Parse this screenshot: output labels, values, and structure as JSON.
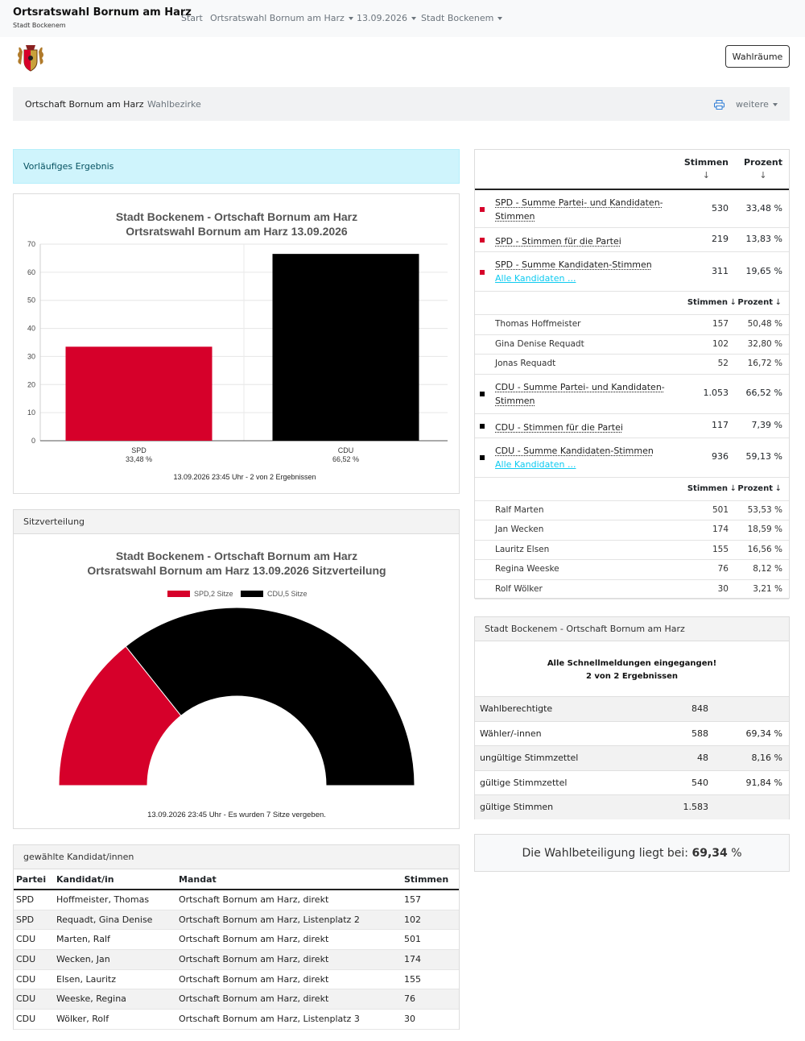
{
  "navbar": {
    "brand_title": "Ortsratswahl Bornum am Harz",
    "brand_sub": "Stadt Bockenem",
    "links": [
      "Start",
      "Ortsratswahl Bornum am Harz",
      "13.09.2026",
      "Stadt Bockenem"
    ]
  },
  "wahlraeume_label": "Wahlräume",
  "breadcrumb": {
    "item1": "Ortschaft Bornum am Harz",
    "item2": "Wahlbezirke",
    "more": "weitere"
  },
  "alert_text": "Vorläufiges Ergebnis",
  "colors": {
    "spd": "#d6002a",
    "cdu": "#000000",
    "info_bg": "#cff4fc"
  },
  "chart_data": [
    {
      "type": "bar",
      "title": "Stadt Bockenem - Ortschaft Bornum am Harz",
      "subtitle": "Ortsratswahl Bornum am Harz 13.09.2026",
      "categories": [
        "SPD",
        "CDU"
      ],
      "category_labels": [
        "33,48 %",
        "66,52 %"
      ],
      "values": [
        33.48,
        66.52
      ],
      "colors": [
        "#d6002a",
        "#000000"
      ],
      "ylim": [
        0,
        70
      ],
      "yticks": [
        "0",
        "10",
        "20",
        "30",
        "40",
        "50",
        "60",
        "70"
      ],
      "footer": "13.09.2026 23:45 Uhr - 2 von 2 Ergebnissen",
      "grid": true
    },
    {
      "type": "pie",
      "title": "Stadt Bockenem - Ortschaft Bornum am Harz",
      "subtitle": "Ortsratswahl Bornum am Harz 13.09.2026 Sitzverteilung",
      "categories": [
        "SPD",
        "CDU"
      ],
      "values": [
        2,
        5
      ],
      "legend": [
        "SPD,2 Sitze",
        "CDU,5 Sitze"
      ],
      "colors": [
        "#d6002a",
        "#000000"
      ],
      "legend_position": "top",
      "footer": "13.09.2026 23:45 Uhr - Es wurden 7 Sitze vergeben."
    }
  ],
  "sitz_header": "Sitzverteilung",
  "results": {
    "col_stimmen": "Stimmen",
    "col_prozent": "Prozent",
    "arrow": "↓",
    "spd_rows": [
      {
        "label_1": "SPD - Summe Partei- und Kandidaten-",
        "label_2": "Stimmen",
        "stimmen": "530",
        "prozent": "33,48 %"
      },
      {
        "label": "SPD - Stimmen für die Partei",
        "stimmen": "219",
        "prozent": "13,83 %"
      },
      {
        "label": "SPD - Summe Kandidaten-Stimmen",
        "link": "Alle Kandidaten ...",
        "stimmen": "311",
        "prozent": "19,65 %"
      }
    ],
    "spd_candidates": [
      {
        "name": "Thomas Hoffmeister",
        "stimmen": "157",
        "prozent": "50,48 %"
      },
      {
        "name": "Gina Denise Requadt",
        "stimmen": "102",
        "prozent": "32,80 %"
      },
      {
        "name": "Jonas Requadt",
        "stimmen": "52",
        "prozent": "16,72 %"
      }
    ],
    "cdu_rows": [
      {
        "label_1": "CDU - Summe Partei- und Kandidaten-",
        "label_2": "Stimmen",
        "stimmen": "1.053",
        "prozent": "66,52 %"
      },
      {
        "label": "CDU - Stimmen für die Partei",
        "stimmen": "117",
        "prozent": "7,39 %"
      },
      {
        "label": "CDU - Summe Kandidaten-Stimmen",
        "link": "Alle Kandidaten ...",
        "stimmen": "936",
        "prozent": "59,13 %"
      }
    ],
    "cdu_candidates": [
      {
        "name": "Ralf Marten",
        "stimmen": "501",
        "prozent": "53,53 %"
      },
      {
        "name": "Jan Wecken",
        "stimmen": "174",
        "prozent": "18,59 %"
      },
      {
        "name": "Lauritz Elsen",
        "stimmen": "155",
        "prozent": "16,56 %"
      },
      {
        "name": "Regina Weeske",
        "stimmen": "76",
        "prozent": "8,12 %"
      },
      {
        "name": "Rolf Wölker",
        "stimmen": "30",
        "prozent": "3,21 %"
      }
    ]
  },
  "summary": {
    "header": "Stadt Bockenem - Ortschaft Bornum am Harz",
    "notice_1": "Alle Schnellmeldungen eingegangen!",
    "notice_2": "2 von 2 Ergebnissen",
    "rows": [
      {
        "label": "Wahlberechtigte",
        "value": "848",
        "pct": ""
      },
      {
        "label": "Wähler/-innen",
        "value": "588",
        "pct": "69,34 %"
      },
      {
        "label": "ungültige Stimmzettel",
        "value": "48",
        "pct": "8,16 %"
      },
      {
        "label": "gültige Stimmzettel",
        "value": "540",
        "pct": "91,84 %"
      },
      {
        "label": "gültige Stimmen",
        "value": "1.583",
        "pct": ""
      }
    ]
  },
  "turnout": {
    "text": "Die Wahlbeteiligung liegt bei:",
    "value": "69,34",
    "unit": "%"
  },
  "elected": {
    "header": "gewählte Kandidat/innen",
    "columns": [
      "Partei",
      "Kandidat/in",
      "Mandat",
      "Stimmen"
    ],
    "rows": [
      [
        "SPD",
        "Hoffmeister, Thomas",
        "Ortschaft Bornum am Harz, direkt",
        "157"
      ],
      [
        "SPD",
        "Requadt, Gina Denise",
        "Ortschaft Bornum am Harz, Listenplatz 2",
        "102"
      ],
      [
        "CDU",
        "Marten, Ralf",
        "Ortschaft Bornum am Harz, direkt",
        "501"
      ],
      [
        "CDU",
        "Wecken, Jan",
        "Ortschaft Bornum am Harz, direkt",
        "174"
      ],
      [
        "CDU",
        "Elsen, Lauritz",
        "Ortschaft Bornum am Harz, direkt",
        "155"
      ],
      [
        "CDU",
        "Weeske, Regina",
        "Ortschaft Bornum am Harz, direkt",
        "76"
      ],
      [
        "CDU",
        "Wölker, Rolf",
        "Ortschaft Bornum am Harz, Listenplatz 3",
        "30"
      ]
    ]
  }
}
